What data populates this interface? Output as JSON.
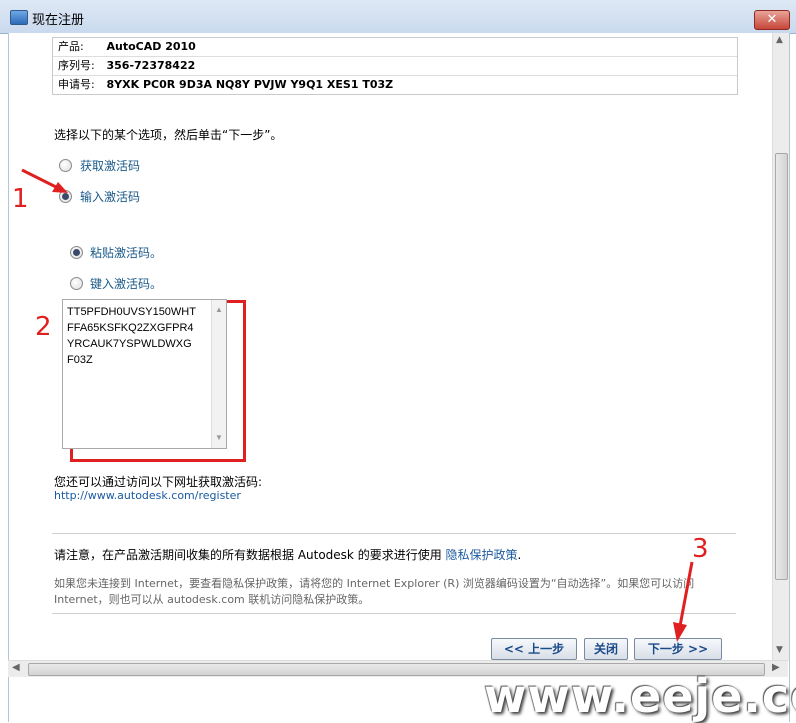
{
  "window": {
    "title": "现在注册",
    "close_glyph": "✕"
  },
  "info": {
    "product_label": "产品:",
    "product_value": "AutoCAD 2010",
    "serial_label": "序列号:",
    "serial_value": "356-72378422",
    "request_label": "申请号:",
    "request_value": "8YXK PC0R 9D3A NQ8Y PVJW Y9Q1 XES1 T03Z"
  },
  "instruction": "选择以下的某个选项，然后单击“下一步”。",
  "options": {
    "get_code": {
      "label": "获取激活码",
      "checked": false
    },
    "enter_code": {
      "label": "输入激活码",
      "checked": true
    },
    "paste_code": {
      "label": "粘贴激活码。",
      "checked": true
    },
    "type_code": {
      "label": "键入激活码。",
      "checked": false
    }
  },
  "activation_code": {
    "lines": [
      "TT5PFDH0UVSY150WHT",
      "FFA65KSFKQ2ZXGFPR4",
      "YRCAUK7YSPWLDWXG",
      "F03Z"
    ]
  },
  "alt_access": {
    "text": "您还可以通过访问以下网址获取激活码:",
    "url": "http://www.autodesk.com/register"
  },
  "notice": {
    "text": "请注意，在产品激活期间收集的所有数据根据 Autodesk 的要求进行使用",
    "privacy_link": "隐私保护政策",
    "end": "."
  },
  "note_gray": "如果您未连接到 Internet，要查看隐私保护政策，请将您的 Internet Explorer (R) 浏览器编码设置为“自动选择”。如果您可以访问 Internet，则也可以从 autodesk.com 联机访问隐私保护政策。",
  "buttons": {
    "back": "<< 上一步",
    "close": "关闭",
    "next": "下一步 >>"
  },
  "annotations": {
    "step1": "1",
    "step2": "2",
    "step3": "3"
  },
  "watermark": "www.eeje.cc",
  "colors": {
    "annotation_red": "#e02020",
    "link_blue": "#1a5aa0"
  }
}
